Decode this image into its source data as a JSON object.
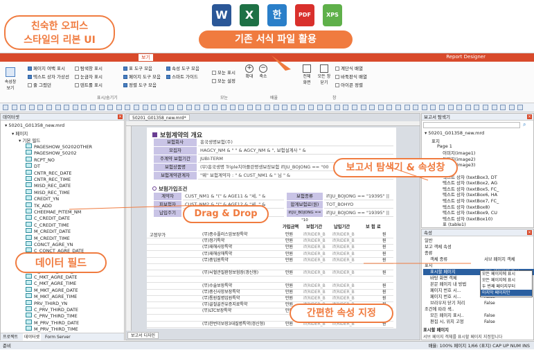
{
  "formats": [
    {
      "letter": "W",
      "color": "#2b5797"
    },
    {
      "letter": "X",
      "color": "#1e7145"
    },
    {
      "letter": "한",
      "color": "#2a7fc9"
    },
    {
      "letter": "PDF",
      "color": "#d9302c"
    },
    {
      "letter": "XPS",
      "color": "#5fb04a"
    }
  ],
  "callouts": {
    "ribbon": "친숙한 오피스\n스타일의 리본 UI",
    "formats": "기존 서식 파일 활용",
    "explorer": "보고서 탐색기 & 속성창",
    "drag": "Drag & Drop",
    "fields": "데이터 필드",
    "props": "간편한 속성 지정"
  },
  "app": {
    "title_right": "Report Designer",
    "tab": "보기",
    "ribbon_items": [
      "페이지 여백 표시",
      "표 도구 모음",
      "속성 도구 모음",
      "텍스트 상자 가상선",
      "페이지 도구 모음",
      "스마트 가이드",
      "줄 그렸던",
      "정렬 도구 모음"
    ],
    "ribbon_items2": [
      "탐색창 표시",
      "눈금자 표시",
      "도움말 표시",
      "텐트롤 표시"
    ],
    "ribbon_labels": [
      "표시/숨기기",
      "모눈",
      "배율",
      "창"
    ],
    "ribbon_buttons": [
      "확대",
      "축소",
      "전체 화면",
      "모든 창 닫기",
      "계단식 배열",
      "바둑판식 배열",
      "아이콘 정렬"
    ],
    "ribbon_side": [
      "모눈 표시",
      "모눈 설정"
    ],
    "ribbon_left": "속성창 보기"
  },
  "left_pane": {
    "title": "데이터셋",
    "root": "50201_G01358_new.mrd",
    "page": "페이지",
    "group": "기본 필드",
    "fields": [
      "PAGESHOW_50202OTHER",
      "PAGESHOW_50202",
      "RCPT_NO",
      "DT",
      "CNTR_REC_DATE",
      "CNTR_REC_TIME",
      "MISD_REC_DATE",
      "MISD_REC_TIME",
      "CREDIT_YN",
      "TK_ADD",
      "CHEEMAE_PITEM_NM",
      "C_CREDIT_DATE",
      "C_CREDIT_TIME",
      "M_CREDIT_DATE",
      "M_CREDIT_TIME",
      "CONCT_AGRE_YN",
      "C_CONCT_AGRE_DATE",
      "C_CONCT_AGRE_TIME",
      "M_CONCT_AGRE_DATE",
      "M_CONCT_AGRE_TIME",
      "C_MKT_AGRE_DATE",
      "C_MKT_AGRE_TIME",
      "M_MKT_AGRE_DATE",
      "M_MKT_AGRE_TIME",
      "PRV_THIRD_YN",
      "C_PRV_THIRD_DATE",
      "C_PRV_THIRD_TIME",
      "M_PRV_THIRD_DATE",
      "M_PRV_THIRD_TIME"
    ],
    "tabs": [
      "프로젝트",
      "데이터셋",
      "Form Server"
    ]
  },
  "doc": {
    "tab": "50201_G01358_new.mrd*",
    "bottom_tab": "보고서 디자인",
    "section1": "보험계약의 개요",
    "rows1": [
      {
        "label": "보험회사",
        "value": "흥국생명보험(주)"
      },
      {
        "label": "모집자",
        "value": "HAGCY_NM & \" \" & AGCY_NM & \", 보험설계사 \" &"
      },
      {
        "label": "주계약 보험기간",
        "value": "JUBI-TERM"
      },
      {
        "label": "보험상품명",
        "value": "(무)흥국생명 Triple치아플란평생보장보험  if(JU_BOJONG == \"00"
      },
      {
        "label": "보험계약관계자",
        "value": "\"웨\" 보험계약자 : \" & CUST_NM1 & \" 님 \" &"
      }
    ],
    "section2": "보험가입조건",
    "rows2": [
      {
        "label": "계약자",
        "value": "CUST_NM1 & \"(\" & AGE11 & \"세, \" &"
      },
      {
        "label": "피보험자",
        "value": "CUST_NM2 & \"(\" & AGE12 & \"세, \" &"
      },
      {
        "label": "납입주기",
        "value": "NABJUGI"
      }
    ],
    "mid_labels": [
      "보험종류",
      "합계보험료(원)",
      "if(JU_BOJONG == \"10"
    ],
    "mid_values": [
      "if(JU_BOJONG == \"19395\" ||",
      "TOT_BOHYO",
      "if(JU_BOJONG == \"19395\" ||"
    ],
    "table_head": [
      "가입금액",
      "보험기간",
      "납입기간",
      "보 험 료"
    ],
    "table_left": "고정부가",
    "table_rows": [
      "(무)종수플러스암보장특약",
      "(무)정기특약",
      "(무)재해사망특약",
      "(무)재해상해특약",
      "(무)중입원특약",
      "",
      "(무)뇌혈관질환정보험장(갱신형)",
      "",
      "(무)수술보장특약",
      "(무)중신사망보장특약",
      "(무)통원질병입원특약",
      "(무)골절골관유증지료특약",
      "(무)LTC보장특약",
      "",
      "(무)한번더보장3대질병특약(갱신형)"
    ],
    "unit": "만원",
    "term_col": "BHTERM",
    "rider_col": "if(RIDER_B",
    "won": "원"
  },
  "explorer": {
    "title": "보고서 탐색기",
    "root": "50201_G01358_new.mrd",
    "items": [
      "표지",
      "Page 1",
      "이미지(image1)",
      "이미지(image2)",
      "이미지(image3)",
      "그룹 4",
      "텍스트 상자 (textBox3, DT",
      "텍스트 상자 (textBox2, AG",
      "텍스트 상자 (textBox5, FC_",
      "텍스트 상자 (textBox6, HA",
      "텍스트 상자 (textBox7, FC_",
      "텍스트 상자 (textBox8)",
      "텍스트 상자 (textBox9, CU",
      "텍스트 상자 (textBox10)",
      "표 (table1)"
    ]
  },
  "props": {
    "title": "속성",
    "rows": [
      {
        "k": "일반",
        "v": ""
      },
      {
        "k": "보고 객체 속성",
        "v": ""
      },
      {
        "k": "종류",
        "v": ""
      },
      {
        "k": "객체 종류",
        "v": "서브 페이지 객체"
      },
      {
        "k": "표시",
        "v": ""
      },
      {
        "k": "표시할 페이지",
        "v": "모든 페이지에 표시"
      },
      {
        "k": "바탕 화면 객체",
        "v": "모든 페이지에 표시"
      },
      {
        "k": "본문 페이지 내 방법",
        "v": "도 번째 페이지부터"
      },
      {
        "k": "페이지 번호 시...",
        "v": "단 번째 페이지"
      },
      {
        "k": "페이지 번호 시...",
        "v": "False"
      },
      {
        "k": "브라우저 닫기 처리",
        "v": "False"
      },
      {
        "k": "조건에 따라 색..",
        "v": ""
      },
      {
        "k": "모든 페이지 표시..",
        "v": "False"
      },
      {
        "k": "편집 시, 위치 고정",
        "v": "False"
      }
    ],
    "dropdown": [
      "모든 페이지에 표시",
      "모든 페이지에 표시",
      "두 번째 페이지부터",
      "마지막 페이지만"
    ],
    "hint_title": "표시할 페이지",
    "hint": "서브 페이지 객체를 표시할 페이지 지정합니다"
  },
  "status": {
    "left": "준비",
    "right": "배율: 100%   페이지 1/66 (표지)   CAP  UP  NUM  INS"
  }
}
